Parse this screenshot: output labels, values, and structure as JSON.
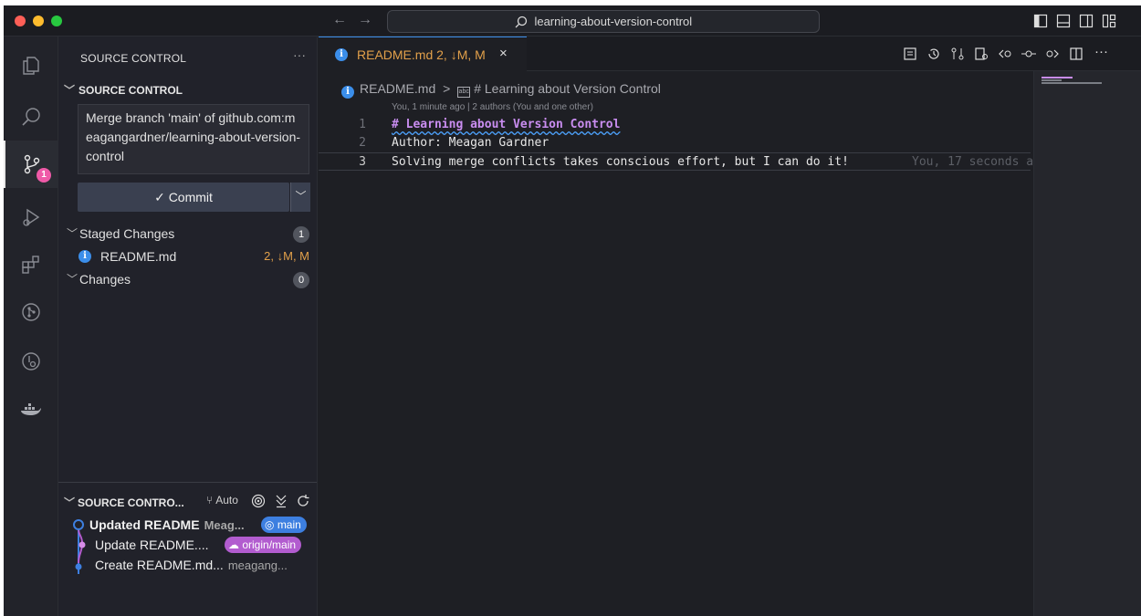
{
  "titlebar": {
    "search_text": "learning-about-version-control",
    "nav_back": "←",
    "nav_forward": "→"
  },
  "activity": {
    "items": [
      "explorer-icon",
      "search-icon",
      "source-control-icon",
      "run-debug-icon",
      "extensions-icon",
      "git-graph-icon",
      "timeline-icon",
      "docker-icon"
    ],
    "source_control_badge": "1"
  },
  "sidebar": {
    "title": "SOURCE CONTROL",
    "more": "···",
    "section_title": "SOURCE CONTROL",
    "commit_message": "Merge branch 'main' of github.com:meagangardner/learning-about-version-control",
    "commit_button": "✓ Commit",
    "staged": {
      "label": "Staged Changes",
      "count": "1"
    },
    "staged_file": {
      "name": "README.md",
      "status": "2, ↓M, M"
    },
    "changes": {
      "label": "Changes",
      "count": "0"
    }
  },
  "graph": {
    "title": "SOURCE CONTRO...",
    "auto": "Auto",
    "commits": [
      {
        "title": "Updated README",
        "author": "Meag...",
        "ref": "main",
        "ref_color": "#3d7fe0"
      },
      {
        "title": "Update README....",
        "author": "",
        "ref": "origin/main",
        "ref_color": "#b25ccf"
      },
      {
        "title": "Create README.md...",
        "author": "meagang...",
        "ref": ""
      }
    ]
  },
  "editor": {
    "tab": {
      "label": "README.md 2, ↓M, M",
      "close": "×"
    },
    "breadcrumb": {
      "file": "README.md",
      "separator": ">",
      "symbol": "# Learning about Version Control"
    },
    "blame_header": "You, 1 minute ago | 2 authors (You and one other)",
    "lines": [
      {
        "num": "1",
        "text": "# Learning about Version Control"
      },
      {
        "num": "2",
        "text": "Author: Meagan Gardner"
      },
      {
        "num": "3",
        "text": "Solving merge conflicts takes conscious effort, but I can do it!"
      }
    ],
    "inline_blame": "You, 17 seconds a"
  },
  "colors": {
    "accent": "#3b8eea",
    "modified": "#e2a04a",
    "heading": "#c98df0",
    "badge": "#ef5aa8"
  }
}
